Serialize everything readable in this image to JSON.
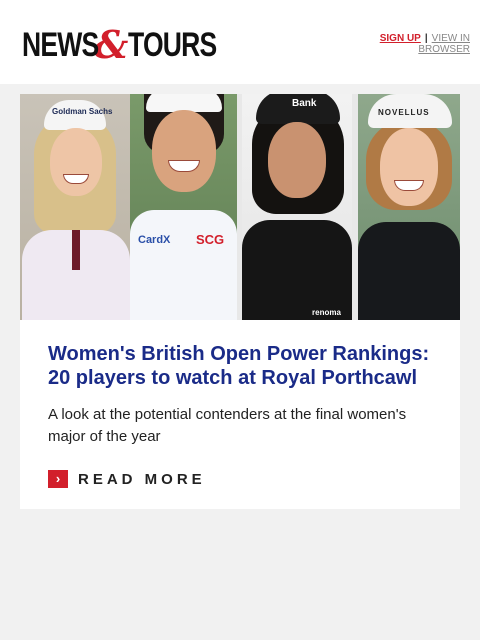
{
  "header": {
    "logo": {
      "word1": "NEWS",
      "amp": "&",
      "word2": "TOURS"
    },
    "links": {
      "signup": "SIGN UP",
      "separator": "|",
      "view": "VIEW IN BROWSER"
    }
  },
  "article": {
    "image_brands": {
      "p1_cap": "Goldman Sachs",
      "p2_shirt_left": "CardX",
      "p2_shirt_right": "SCG",
      "p3_cap": "Bank",
      "p3_shirt": "renoma",
      "p4_cap": "NOVELLUS"
    },
    "title": "Women's British Open Power Rankings: 20 players to watch at Royal Porthcawl",
    "description": "A look at the potential contenders at the final women's major of the year",
    "read_more": {
      "icon": "chevron-right-icon",
      "label": "READ MORE"
    }
  },
  "colors": {
    "accent": "#d21f2b",
    "title": "#1a2b88",
    "background": "#f1f1f1"
  }
}
